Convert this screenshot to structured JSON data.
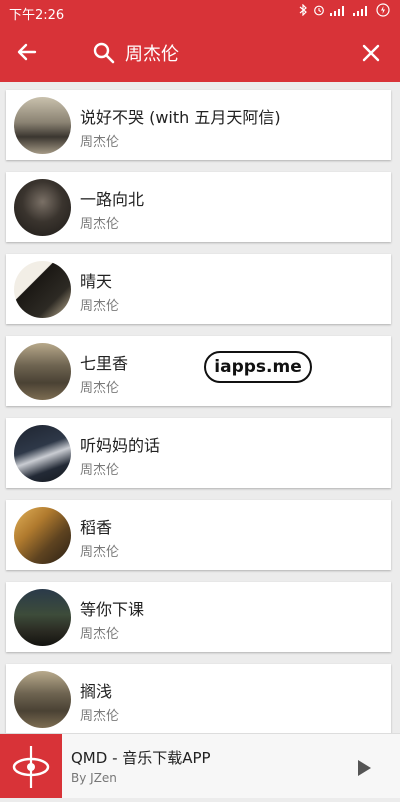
{
  "status": {
    "time": "下午2:26",
    "icons": [
      "bluetooth-icon",
      "alarm-icon",
      "signal-icon",
      "signal-icon",
      "battery-icon"
    ]
  },
  "appbar": {
    "query": "周杰伦",
    "accent": "#d83338"
  },
  "songs": [
    {
      "title": "说好不哭 (with 五月天阿信)",
      "artist": "周杰伦"
    },
    {
      "title": "一路向北",
      "artist": "周杰伦"
    },
    {
      "title": "晴天",
      "artist": "周杰伦"
    },
    {
      "title": "七里香",
      "artist": "周杰伦"
    },
    {
      "title": "听妈妈的话",
      "artist": "周杰伦"
    },
    {
      "title": "稻香",
      "artist": "周杰伦"
    },
    {
      "title": "等你下课",
      "artist": "周杰伦"
    },
    {
      "title": "搁浅",
      "artist": "周杰伦"
    }
  ],
  "watermark": "iapps.me",
  "player": {
    "title": "QMD - 音乐下载APP",
    "subtitle": "By JZen"
  }
}
